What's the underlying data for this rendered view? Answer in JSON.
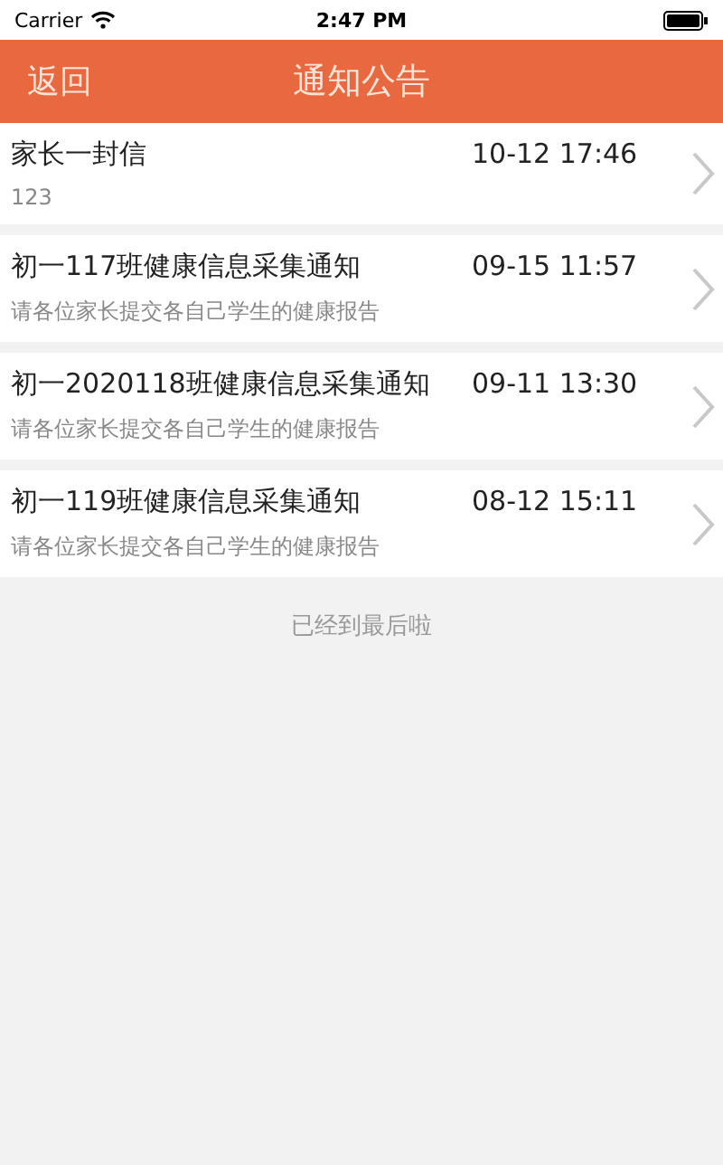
{
  "status_bar": {
    "carrier": "Carrier",
    "time": "2:47 PM"
  },
  "nav_bar": {
    "back": "返回",
    "title": "通知公告"
  },
  "notices": [
    {
      "title": "家长一封信",
      "date": "10-12 17:46",
      "summary": "123"
    },
    {
      "title": "初一117班健康信息采集通知",
      "date": "09-15 11:57",
      "summary": "请各位家长提交各自己学生的健康报告"
    },
    {
      "title": "初一2020118班健康信息采集通知",
      "date": "09-11 13:30",
      "summary": "请各位家长提交各自己学生的健康报告"
    },
    {
      "title": "初一119班健康信息采集通知",
      "date": "08-12 15:11",
      "summary": "请各位家长提交各自己学生的健康报告"
    }
  ],
  "end_text": "已经到最后啦"
}
